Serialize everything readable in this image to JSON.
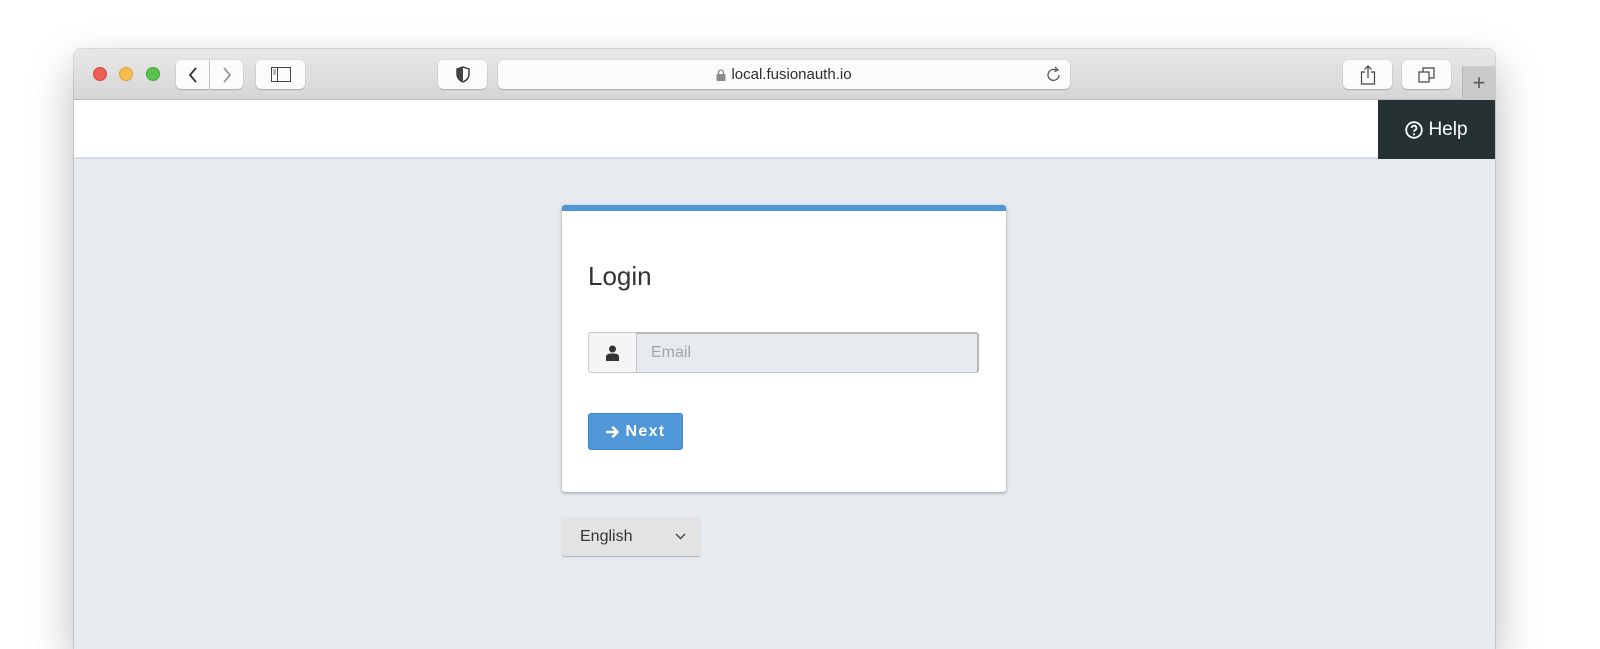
{
  "browser": {
    "url": "local.fusionauth.io",
    "buttons": {
      "back": "back-icon",
      "forward": "forward-icon",
      "sidebar": "sidebar-icon",
      "privacy": "shield-icon",
      "share": "share-icon",
      "tabs": "tabs-icon",
      "new_tab": "+"
    }
  },
  "header": {
    "help_label": "Help"
  },
  "login": {
    "title": "Login",
    "email_placeholder": "Email",
    "email_value": "",
    "next_label": "Next"
  },
  "locale": {
    "selected": "English"
  },
  "colors": {
    "accent": "#4f97d6",
    "help_bg": "#263133",
    "page_bg": "#e7ebef"
  }
}
